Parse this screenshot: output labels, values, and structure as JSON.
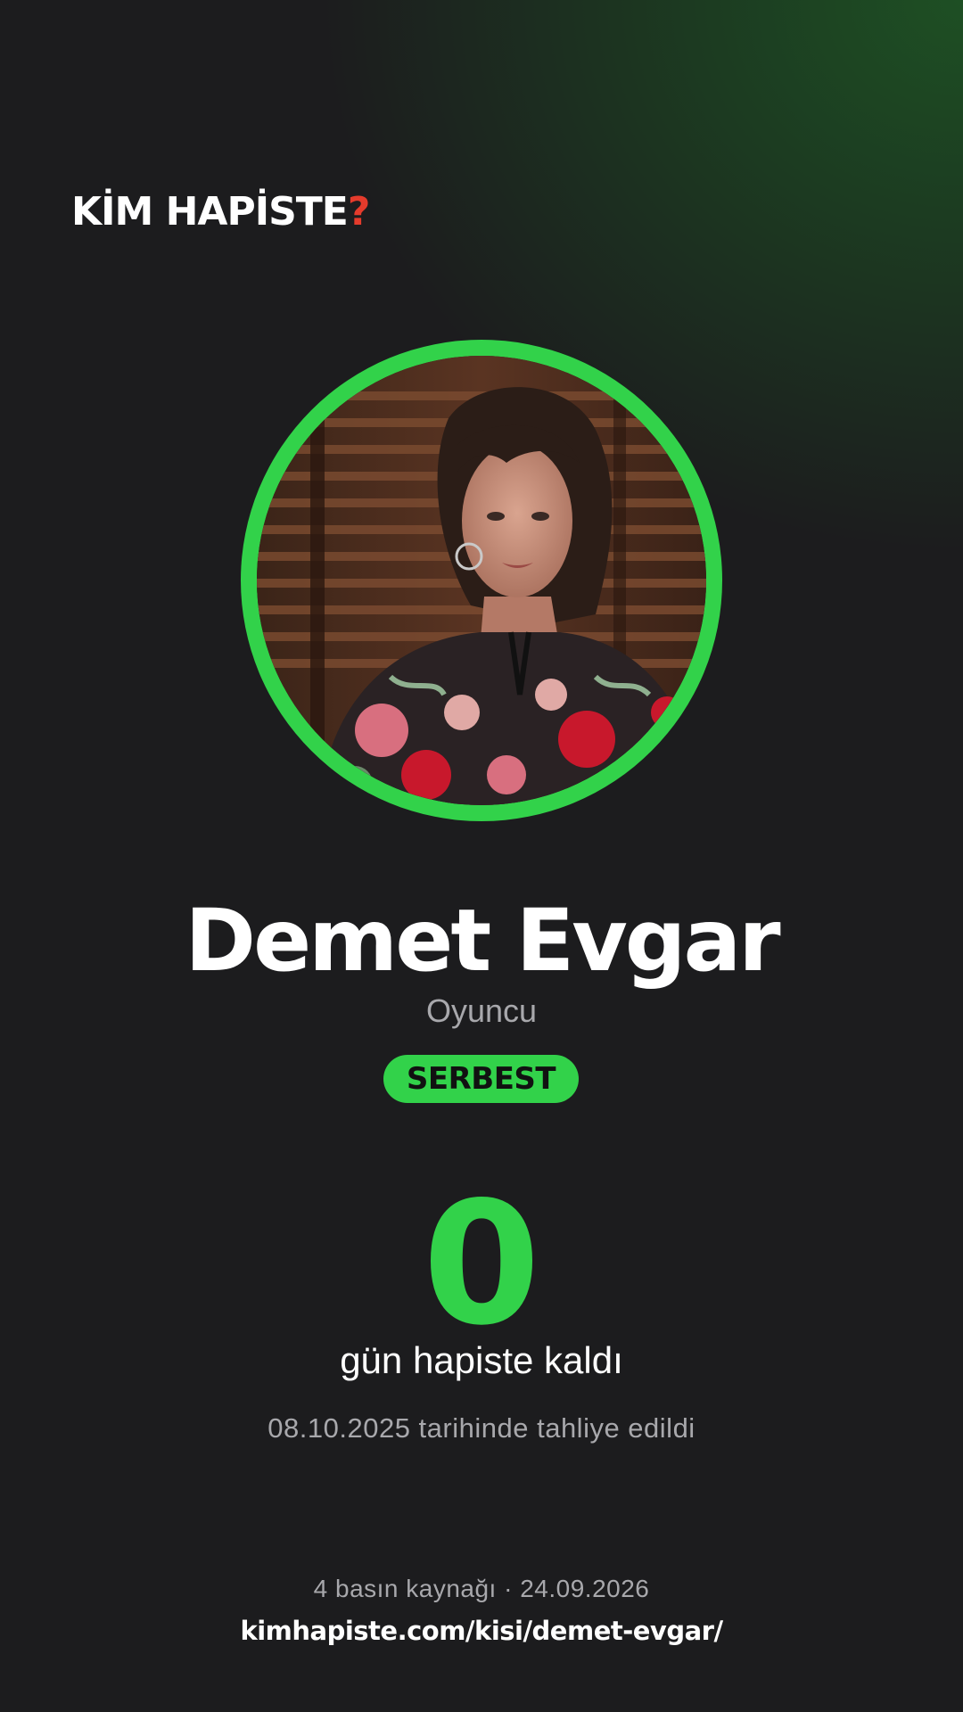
{
  "logo": {
    "text": "KİM HAPİSTE",
    "mark": "?"
  },
  "person": {
    "name": "Demet Evgar",
    "role": "Oyuncu",
    "status": "SERBEST",
    "photo_icon": "portrait-photo"
  },
  "stats": {
    "days": "0",
    "days_label": "gün hapiste kaldı",
    "release_text": "08.10.2025 tarihinde tahliye edildi"
  },
  "footer": {
    "sources": "4 basın kaynağı · 24.09.2026",
    "url": "kimhapiste.com/kisi/demet-evgar/"
  },
  "colors": {
    "accent": "#32d24a",
    "logo_mark": "#e53b2c",
    "background": "#1c1c1e",
    "muted_text": "#a8a8ac"
  }
}
